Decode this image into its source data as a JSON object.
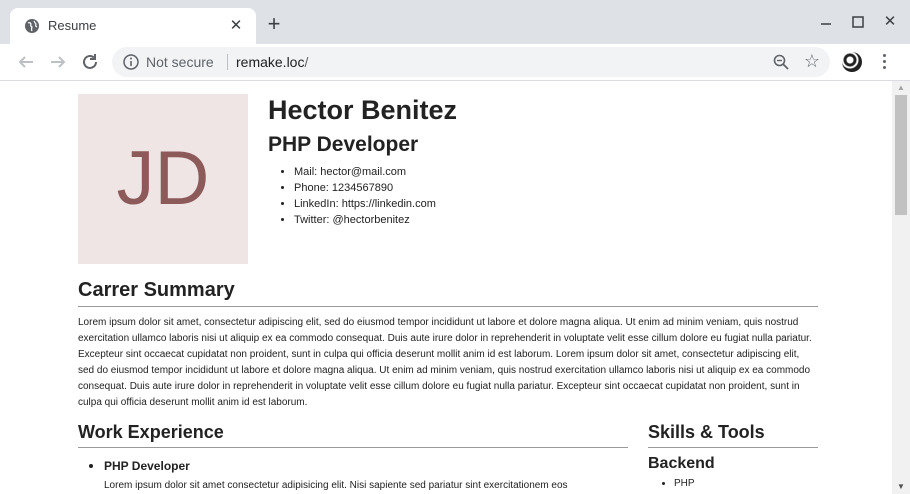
{
  "browser": {
    "tab_title": "Resume",
    "new_tab_label": "+",
    "security_label": "Not secure",
    "url_host": "remake.loc",
    "url_path": "/"
  },
  "icons": {
    "globe": "globe-icon",
    "close": "close-icon",
    "back": "back-arrow-icon",
    "forward": "forward-arrow-icon",
    "reload": "reload-icon",
    "info": "info-icon",
    "zoom": "zoom-out-icon",
    "star": "star-icon",
    "menu": "kebab-menu-icon"
  },
  "colors": {
    "photo_bg": "#efe5e5",
    "photo_text": "#8d5a5a",
    "tabstrip": "#dee1e6"
  },
  "profile": {
    "initials": "JD",
    "name": "Hector Benitez",
    "role": "PHP Developer",
    "contacts": [
      "Mail: hector@mail.com",
      "Phone: 1234567890",
      "LinkedIn: https://linkedin.com",
      "Twitter: @hectorbenitez"
    ]
  },
  "summary": {
    "title": "Carrer Summary",
    "text": "Lorem ipsum dolor sit amet, consectetur adipiscing elit, sed do eiusmod tempor incididunt ut labore et dolore magna aliqua. Ut enim ad minim veniam, quis nostrud exercitation ullamco laboris nisi ut aliquip ex ea commodo consequat. Duis aute irure dolor in reprehenderit in voluptate velit esse cillum dolore eu fugiat nulla pariatur. Excepteur sint occaecat cupidatat non proident, sunt in culpa qui officia deserunt mollit anim id est laborum. Lorem ipsum dolor sit amet, consectetur adipiscing elit, sed do eiusmod tempor incididunt ut labore et dolore magna aliqua. Ut enim ad minim veniam, quis nostrud exercitation ullamco laboris nisi ut aliquip ex ea commodo consequat. Duis aute irure dolor in reprehenderit in voluptate velit esse cillum dolore eu fugiat nulla pariatur. Excepteur sint occaecat cupidatat non proident, sunt in culpa qui officia deserunt mollit anim id est laborum."
  },
  "work": {
    "title": "Work Experience",
    "jobs": [
      {
        "title": "PHP Developer",
        "description": "Lorem ipsum dolor sit amet consectetur adipisicing elit. Nisi sapiente sed pariatur sint exercitationem eos"
      }
    ]
  },
  "skills": {
    "title": "Skills & Tools",
    "groups": [
      {
        "name": "Backend",
        "items": [
          "PHP"
        ]
      }
    ]
  }
}
